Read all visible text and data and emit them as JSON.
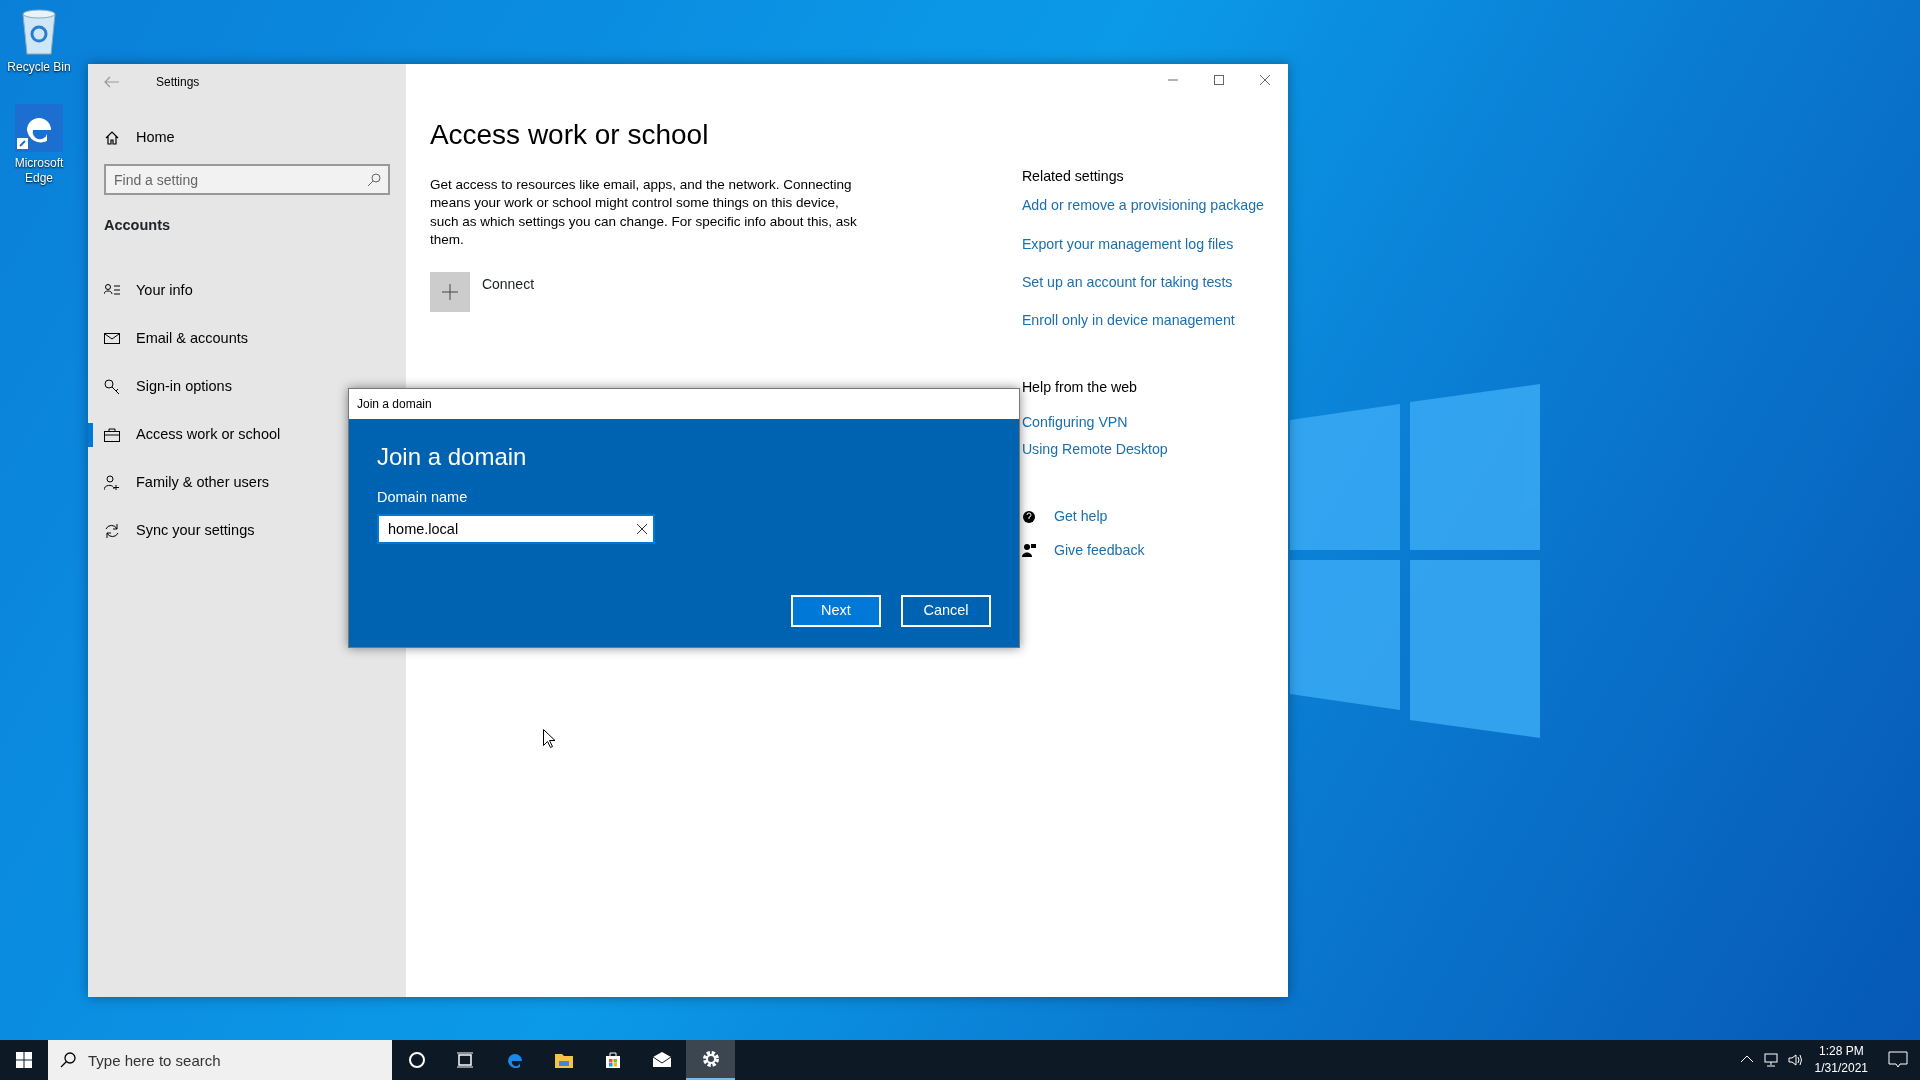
{
  "desktop_icons": [
    {
      "label": "Recycle Bin"
    },
    {
      "label": "Microsoft Edge"
    }
  ],
  "settings_window": {
    "title": "Settings",
    "sidebar": {
      "home": "Home",
      "search": {
        "placeholder": "Find a setting"
      },
      "section": "Accounts",
      "items": [
        {
          "label": "Your info",
          "selected": false
        },
        {
          "label": "Email & accounts",
          "selected": false
        },
        {
          "label": "Sign-in options",
          "selected": false
        },
        {
          "label": "Access work or school",
          "selected": true
        },
        {
          "label": "Family & other users",
          "selected": false
        },
        {
          "label": "Sync your settings",
          "selected": false
        }
      ]
    },
    "page": {
      "title": "Access work or school",
      "description": "Get access to resources like email, apps, and the network. Connecting means your work or school might control some things on this device, such as which settings you can change. For specific info about this, ask them.",
      "connect": "Connect"
    },
    "related": {
      "heading": "Related settings",
      "links": [
        "Add or remove a provisioning package",
        "Export your management log files",
        "Set up an account for taking tests",
        "Enroll only in device management"
      ]
    },
    "help": {
      "heading": "Help from the web",
      "links": [
        "Configuring VPN",
        "Using Remote Desktop"
      ],
      "get_help": "Get help",
      "give_feedback": "Give feedback"
    }
  },
  "dialog": {
    "title": "Join a domain",
    "heading": "Join a domain",
    "field_label": "Domain name",
    "value": "home.local",
    "buttons": [
      "Next",
      "Cancel"
    ]
  },
  "taskbar": {
    "search": {
      "placeholder": "Type here to search"
    },
    "apps": [
      {
        "active": false
      },
      {
        "active": false
      },
      {
        "active": false
      },
      {
        "active": false
      },
      {
        "active": false
      },
      {
        "active": false
      },
      {
        "active": true
      }
    ],
    "time": "1:28 PM",
    "date": "1/31/2021"
  }
}
